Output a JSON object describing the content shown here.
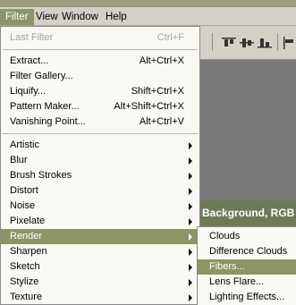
{
  "menubar": {
    "items": [
      {
        "label": "Filter",
        "active": true
      },
      {
        "label": "View",
        "active": false
      },
      {
        "label": "Window",
        "active": false
      },
      {
        "label": "Help",
        "active": false
      }
    ]
  },
  "filter_menu": {
    "last_filter": {
      "label": "Last Filter",
      "shortcut": "Ctrl+F"
    },
    "group1": [
      {
        "label": "Extract...",
        "shortcut": "Alt+Ctrl+X"
      },
      {
        "label": "Filter Gallery...",
        "shortcut": ""
      },
      {
        "label": "Liquify...",
        "shortcut": "Shift+Ctrl+X"
      },
      {
        "label": "Pattern Maker...",
        "shortcut": "Alt+Shift+Ctrl+X"
      },
      {
        "label": "Vanishing Point...",
        "shortcut": "Alt+Ctrl+V"
      }
    ],
    "group2": [
      {
        "label": "Artistic"
      },
      {
        "label": "Blur"
      },
      {
        "label": "Brush Strokes"
      },
      {
        "label": "Distort"
      },
      {
        "label": "Noise"
      },
      {
        "label": "Pixelate"
      },
      {
        "label": "Render"
      },
      {
        "label": "Sharpen"
      },
      {
        "label": "Sketch"
      },
      {
        "label": "Stylize"
      },
      {
        "label": "Texture"
      }
    ],
    "highlighted": "Render"
  },
  "render_submenu": {
    "items": [
      "Clouds",
      "Difference Clouds",
      "Fibers...",
      "Lens Flare...",
      "Lighting Effects..."
    ],
    "highlighted": "Fibers..."
  },
  "document": {
    "title": "Background, RGB"
  },
  "colors": {
    "highlight": "#8b9568",
    "menu_bg": "#f9f8f3",
    "chrome": "#d4d0c8"
  }
}
